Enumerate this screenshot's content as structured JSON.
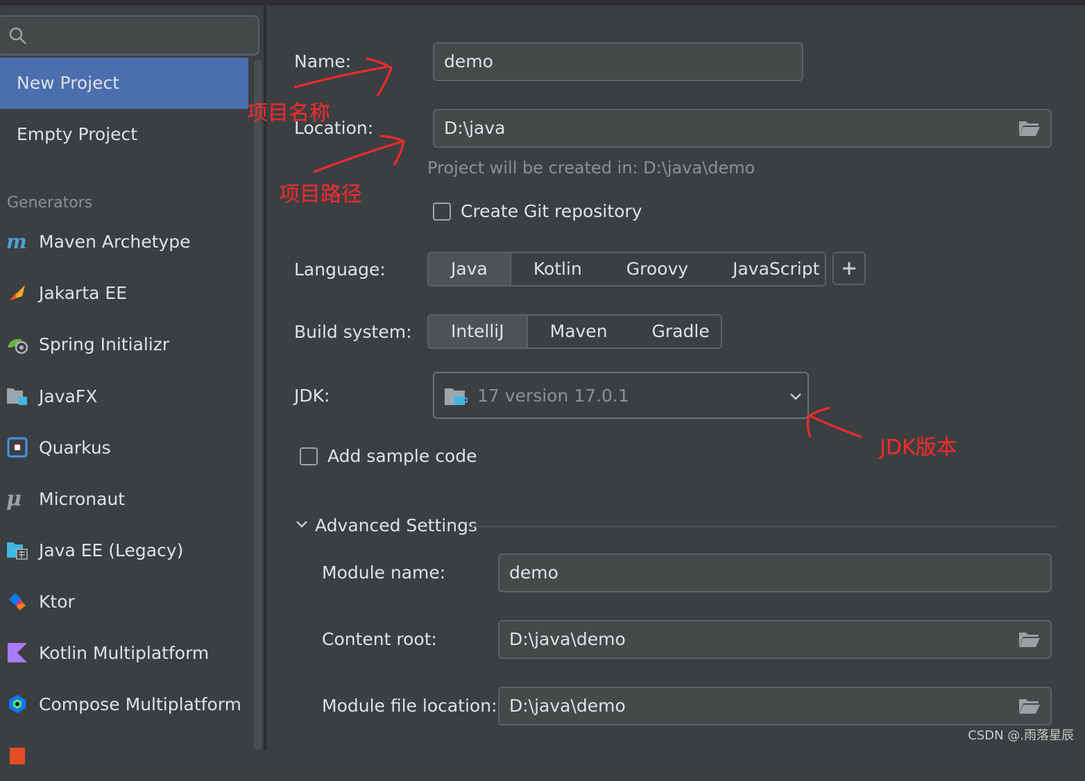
{
  "sidebar": {
    "search_placeholder": "",
    "nav": [
      {
        "label": "New Project",
        "selected": true
      },
      {
        "label": "Empty Project",
        "selected": false
      }
    ],
    "generators_label": "Generators",
    "generators": [
      {
        "label": "Maven Archetype",
        "icon": "maven-icon"
      },
      {
        "label": "Jakarta EE",
        "icon": "jakarta-ee-icon"
      },
      {
        "label": "Spring Initializr",
        "icon": "spring-icon"
      },
      {
        "label": "JavaFX",
        "icon": "javafx-icon"
      },
      {
        "label": "Quarkus",
        "icon": "quarkus-icon"
      },
      {
        "label": "Micronaut",
        "icon": "micronaut-icon"
      },
      {
        "label": "Java EE (Legacy)",
        "icon": "java-ee-icon"
      },
      {
        "label": "Ktor",
        "icon": "ktor-icon"
      },
      {
        "label": "Kotlin Multiplatform",
        "icon": "kotlin-icon"
      },
      {
        "label": "Compose Multiplatform",
        "icon": "compose-icon"
      }
    ]
  },
  "form": {
    "name_label": "Name:",
    "name_value": "demo",
    "location_label": "Location:",
    "location_value": "D:\\java",
    "location_hint": "Project will be created in: D:\\java\\demo",
    "git_label": "Create Git repository",
    "git_checked": false,
    "language_label": "Language:",
    "languages": [
      "Java",
      "Kotlin",
      "Groovy",
      "JavaScript"
    ],
    "language_selected": "Java",
    "build_label": "Build system:",
    "build_systems": [
      "IntelliJ",
      "Maven",
      "Gradle"
    ],
    "build_selected": "IntelliJ",
    "jdk_label": "JDK:",
    "jdk_value": "17 version 17.0.1",
    "sample_label": "Add sample code",
    "sample_checked": false,
    "advanced_label": "Advanced Settings",
    "module_name_label": "Module name:",
    "module_name_value": "demo",
    "content_root_label": "Content root:",
    "content_root_value": "D:\\java\\demo",
    "module_file_label": "Module file location:",
    "module_file_value": "D:\\java\\demo"
  },
  "annotations": {
    "name_note": "项目名称",
    "location_note": "项目路径",
    "jdk_note": "JDK版本"
  },
  "watermark": "CSDN @.雨落星辰",
  "colors": {
    "background": "#3c3f41",
    "selection": "#4b6eaf",
    "annotation": "#ff2a2a"
  }
}
